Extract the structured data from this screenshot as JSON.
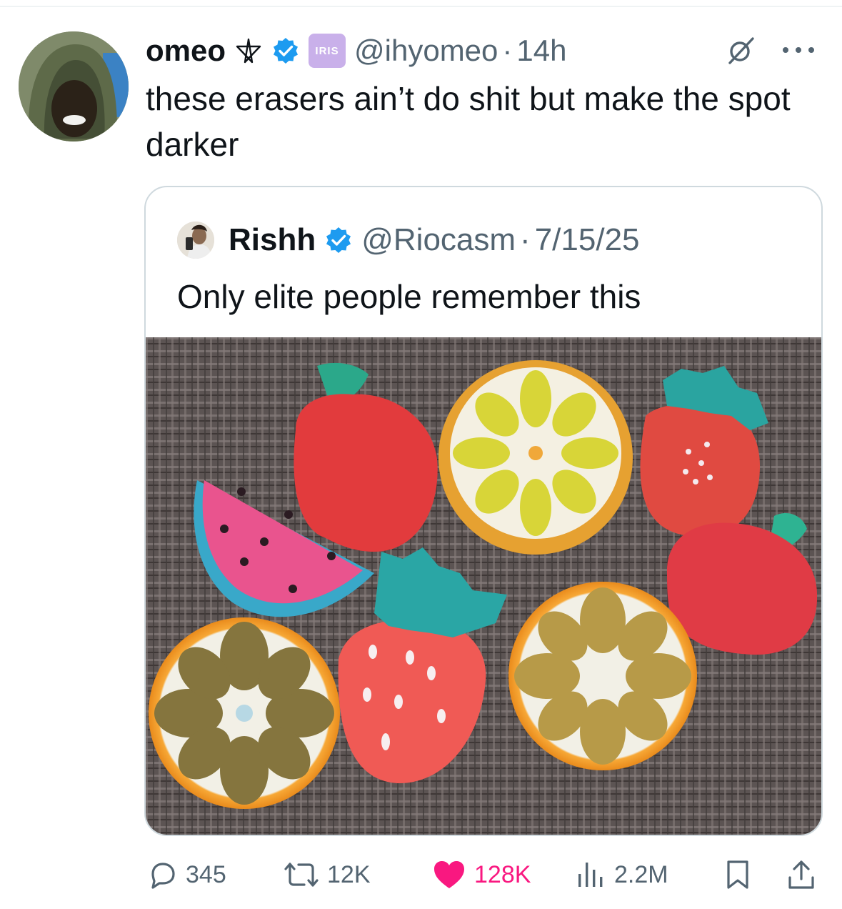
{
  "post": {
    "author": {
      "display_name": "omeo",
      "handle": "@ihyomeo",
      "badge_label": "IRIS",
      "avatar": "hooded-person-avatar"
    },
    "time_dot": "·",
    "time": "14h",
    "text": "these erasers ain’t do shit but make the spot darker",
    "icons": {
      "grok": "grok-icon",
      "more": "more-options-icon",
      "verified": "verified-badge-icon",
      "symbol": "pentagram-icon"
    }
  },
  "quote": {
    "author": {
      "display_name": "Rishh",
      "handle": "@Riocasm",
      "avatar": "selfie-avatar"
    },
    "date_dot": "·",
    "date": "7/15/25",
    "text": "Only elite people remember this",
    "image": "fruit-shaped erasers on a woven mat"
  },
  "stats": {
    "replies": "345",
    "reposts": "12K",
    "likes": "128K",
    "views": "2.2M"
  },
  "colors": {
    "verified": "#1d9bf0",
    "like": "#f91880",
    "muted": "#536471",
    "border": "#cfd9de",
    "iris": "#c9b0ea"
  }
}
